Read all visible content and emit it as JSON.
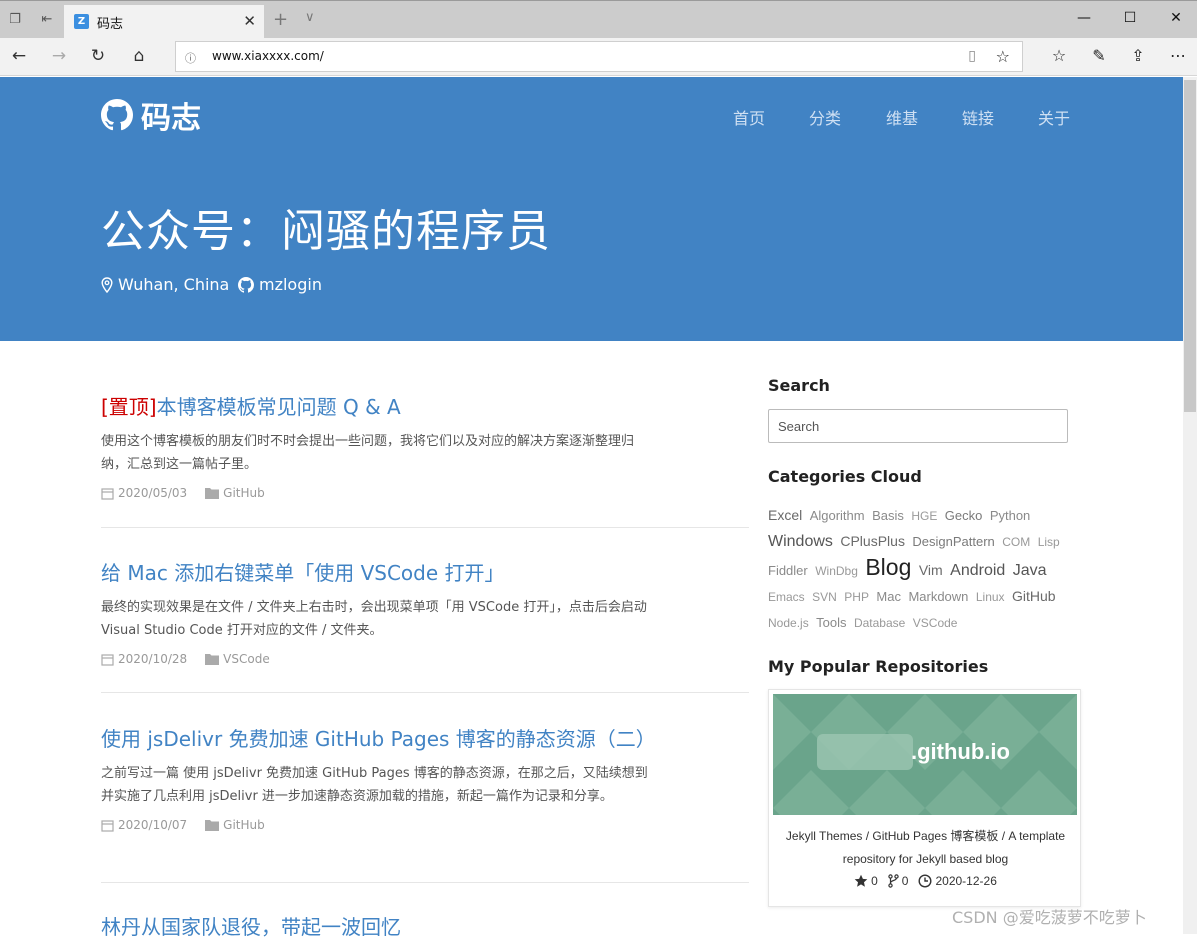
{
  "browser": {
    "tab_title": "码志",
    "url": "www.xiaxxxx.com/",
    "colors": {
      "chrome": "#cccccc",
      "toolbar": "#f2f2f2"
    }
  },
  "site": {
    "brand": "码志",
    "nav": [
      "首页",
      "分类",
      "维基",
      "链接",
      "关于"
    ],
    "hero_title": "公众号：闷骚的程序员",
    "location": "Wuhan, China",
    "github_user": "mzlogin",
    "accent": "#4183c4"
  },
  "posts": [
    {
      "pin": "[置顶]",
      "title": "本博客模板常见问题 Q & A",
      "excerpt": "使用这个博客模板的朋友们时不时会提出一些问题，我将它们以及对应的解决方案逐渐整理归纳，汇总到这一篇帖子里。",
      "date": "2020/05/03",
      "category": "GitHub"
    },
    {
      "pin": "",
      "title": "给 Mac 添加右键菜单「使用 VSCode 打开」",
      "excerpt": "最终的实现效果是在文件 / 文件夹上右击时，会出现菜单项「用 VSCode 打开」，点击后会启动 Visual Studio Code 打开对应的文件 / 文件夹。",
      "date": "2020/10/28",
      "category": "VSCode"
    },
    {
      "pin": "",
      "title": "使用 jsDelivr 免费加速 GitHub Pages 博客的静态资源（二）",
      "excerpt": "之前写过一篇 使用 jsDelivr 免费加速 GitHub Pages 博客的静态资源，在那之后，又陆续想到并实施了几点利用 jsDelivr 进一步加速静态资源加载的措施，新起一篇作为记录和分享。",
      "date": "2020/10/07",
      "category": "GitHub"
    },
    {
      "pin": "",
      "title": "林丹从国家队退役，带起一波回忆",
      "excerpt": "",
      "date": "",
      "category": ""
    }
  ],
  "sidebar": {
    "search_heading": "Search",
    "search_placeholder": "Search",
    "categories_heading": "Categories Cloud",
    "categories": [
      {
        "name": "Excel",
        "weight": 3
      },
      {
        "name": "Algorithm",
        "weight": 1
      },
      {
        "name": "Basis",
        "weight": 1
      },
      {
        "name": "HGE",
        "weight": 0
      },
      {
        "name": "Gecko",
        "weight": 2
      },
      {
        "name": "Python",
        "weight": 1
      },
      {
        "name": "Windows",
        "weight": 4
      },
      {
        "name": "CPlusPlus",
        "weight": 3
      },
      {
        "name": "DesignPattern",
        "weight": 2
      },
      {
        "name": "COM",
        "weight": 0
      },
      {
        "name": "Lisp",
        "weight": 0
      },
      {
        "name": "Fiddler",
        "weight": 1
      },
      {
        "name": "WinDbg",
        "weight": 0
      },
      {
        "name": "Blog",
        "weight": 6
      },
      {
        "name": "Vim",
        "weight": 3
      },
      {
        "name": "Android",
        "weight": 4
      },
      {
        "name": "Java",
        "weight": 4
      },
      {
        "name": "Emacs",
        "weight": 0
      },
      {
        "name": "SVN",
        "weight": 0
      },
      {
        "name": "PHP",
        "weight": 0
      },
      {
        "name": "Mac",
        "weight": 1
      },
      {
        "name": "Markdown",
        "weight": 1
      },
      {
        "name": "Linux",
        "weight": 0
      },
      {
        "name": "GitHub",
        "weight": 3
      },
      {
        "name": "Node.js",
        "weight": 0
      },
      {
        "name": "Tools",
        "weight": 1
      },
      {
        "name": "Database",
        "weight": 0
      },
      {
        "name": "VSCode",
        "weight": 0
      }
    ],
    "repos_heading": "My Popular Repositories",
    "repo": {
      "image_text": ".github.io",
      "desc": "Jekyll Themes / GitHub Pages 博客模板 / A template repository for Jekyll based blog",
      "stars": "0",
      "forks": "0",
      "updated": "2020-12-26"
    }
  },
  "watermark": "CSDN @爱吃菠萝不吃萝卜"
}
